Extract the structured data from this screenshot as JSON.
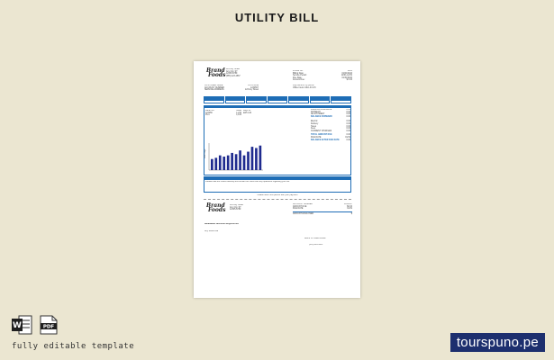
{
  "page": {
    "title": "UTILITY BILL"
  },
  "footer": {
    "caption": "fully editable template",
    "brand": "tourspuno.pe"
  },
  "icons": {
    "word": "word-file-icon",
    "pdf": "pdf-file-icon",
    "pdf_label": "PDF",
    "word_letter": "W"
  },
  "bill": {
    "logo": "Brand Foods",
    "logo_line1": "Brand",
    "logo_line2": "Foods",
    "account_rows": [
      "CUSTOMER NAME",
      "ACCOUNT NUMBER",
      "SERVICE ADDRESS"
    ],
    "account_values": [
      "JOHN DOE",
      "1234567",
      "123 Any Street"
    ],
    "sections": [
      "PAYMENTS RECEIVED",
      "BILLING DETAILS",
      "CURRENT CHARGES"
    ],
    "summary_labels": [
      "PREVIOUS BALANCE",
      "PAYMENT",
      "ADJUSTMENT",
      "BALANCE FORWARD",
      "CURRENT CHARGES",
      "TOTAL AMOUNT DUE",
      "DUE DATE",
      "BALANCE AFTER DUE DATE"
    ],
    "stub_title": "REMINDER SERVICE REQUESTED",
    "stub_labels": [
      "ACCOUNT NUMBER",
      "AMOUNT DUE",
      "DUE DATE",
      "AMOUNT ENCLOSED"
    ],
    "phone": "(555) 123-4567"
  },
  "chart_data": {
    "type": "bar",
    "categories": [
      "1",
      "2",
      "3",
      "4",
      "5",
      "6",
      "7",
      "8",
      "9",
      "10",
      "11",
      "12",
      "13"
    ],
    "values": [
      45,
      50,
      60,
      55,
      60,
      70,
      65,
      80,
      60,
      75,
      95,
      90,
      100
    ],
    "ylabel": "",
    "xlabel": "",
    "ylim": [
      0,
      110
    ]
  }
}
